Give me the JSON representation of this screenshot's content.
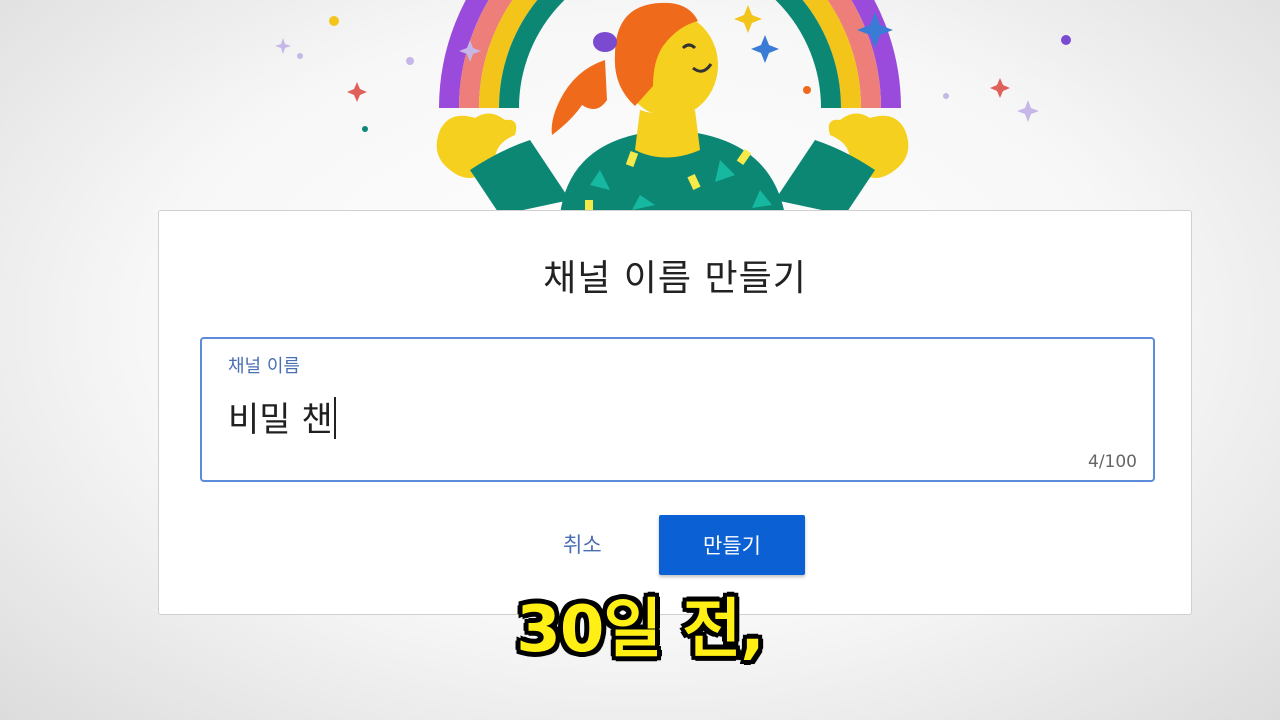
{
  "dialog": {
    "title": "채널 이름 만들기",
    "field": {
      "label": "채널 이름",
      "value": "비밀 챈",
      "counter": "4/100"
    },
    "cancel_label": "취소",
    "create_label": "만들기"
  },
  "caption": "30일 전,",
  "colors": {
    "primary_button": "#0b61d4",
    "field_border": "#5b8bd9",
    "caption_text": "#ffef14"
  },
  "illustration": {
    "description_icon": "rainbow-person-icon"
  }
}
